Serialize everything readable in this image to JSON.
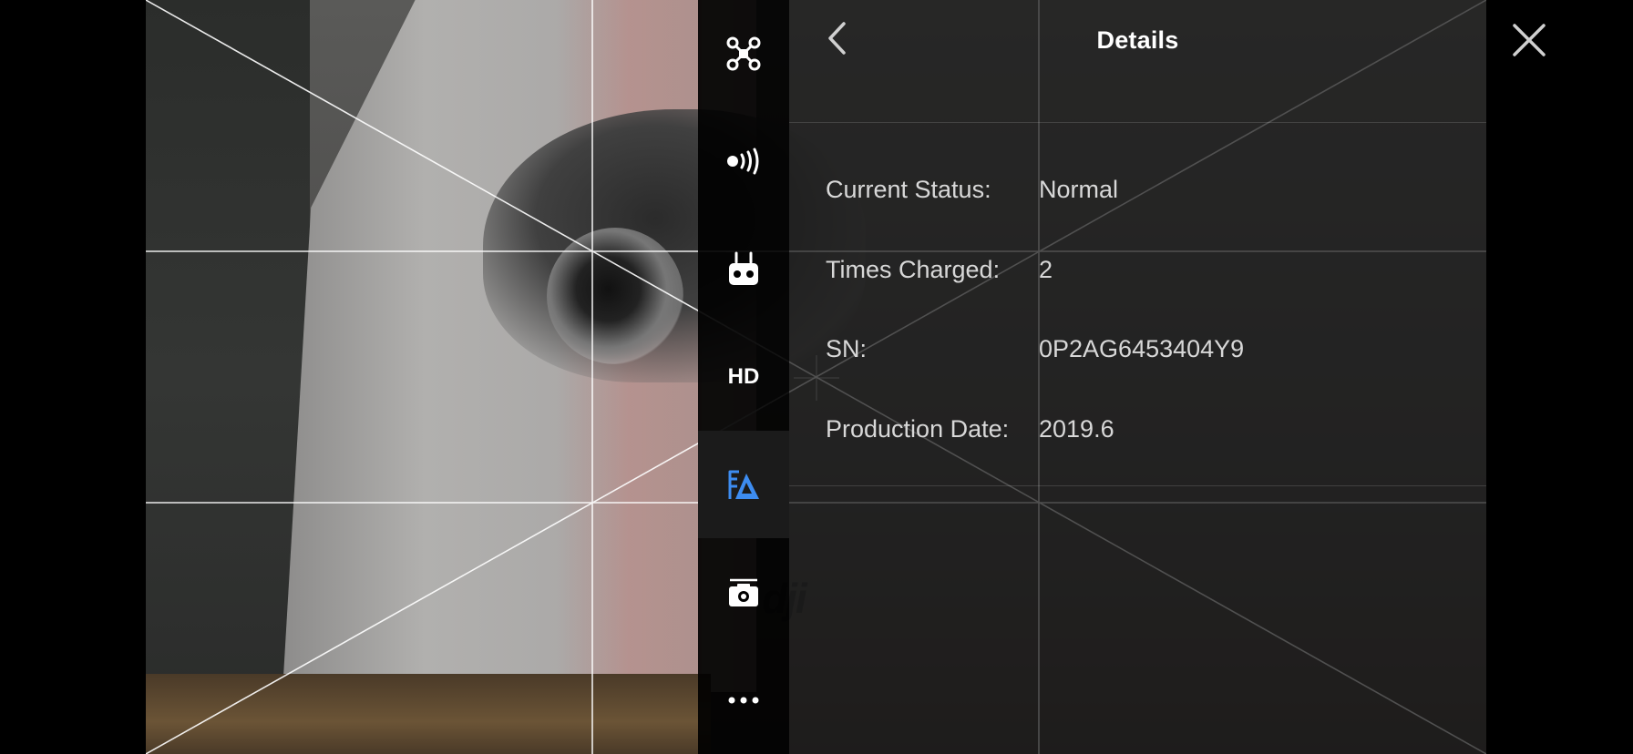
{
  "panel": {
    "title": "Details"
  },
  "sidebar": {
    "items": [
      {
        "name": "aircraft",
        "icon": "drone-icon",
        "active": false
      },
      {
        "name": "transmission",
        "icon": "signal-icon",
        "active": false
      },
      {
        "name": "remote-controller",
        "icon": "remote-controller-icon",
        "active": false
      },
      {
        "name": "hd",
        "label": "HD",
        "active": false
      },
      {
        "name": "battery",
        "icon": "battery-icon",
        "active": true
      },
      {
        "name": "camera",
        "icon": "camera-icon",
        "active": false
      },
      {
        "name": "more",
        "icon": "more-icon",
        "active": false
      }
    ]
  },
  "details": {
    "rows": [
      {
        "label": "Current Status:",
        "value": "Normal"
      },
      {
        "label": "Times Charged:",
        "value": "2"
      },
      {
        "label": "SN:",
        "value": "0P2AG6453404Y9"
      },
      {
        "label": "Production Date:",
        "value": "2019.6"
      }
    ]
  },
  "watermark": "dji",
  "colors": {
    "accent": "#3d8cf0",
    "text": "#d8d8d8",
    "title": "#ffffff"
  }
}
